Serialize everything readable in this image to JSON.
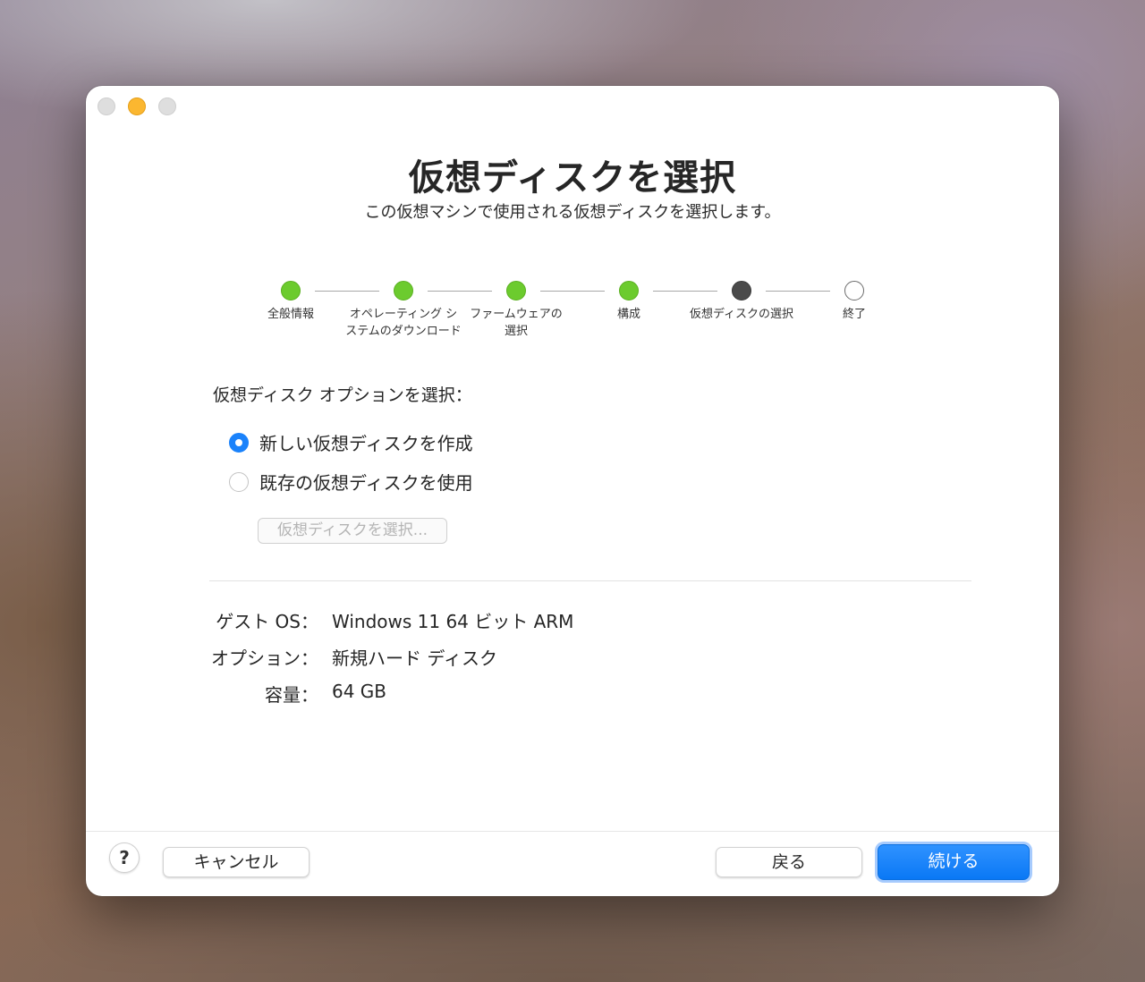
{
  "window": {
    "title": "仮想ディスクを選択",
    "subtitle": "この仮想マシンで使用される仮想ディスクを選択します。"
  },
  "steps": [
    {
      "label": "全般情報",
      "state": "done"
    },
    {
      "label": "オペレーティング システムのダウンロード",
      "state": "done"
    },
    {
      "label": "ファームウェアの 選択",
      "state": "done"
    },
    {
      "label": "構成",
      "state": "done"
    },
    {
      "label": "仮想ディスクの選択",
      "state": "current"
    },
    {
      "label": "終了",
      "state": "pending"
    }
  ],
  "options": {
    "section_label": "仮想ディスク オプションを選択：",
    "create_new_label": "新しい仮想ディスクを作成",
    "use_existing_label": "既存の仮想ディスクを使用",
    "selected": "create_new",
    "choose_button_label": "仮想ディスクを選択..."
  },
  "summary": {
    "guest_os_label": "ゲスト OS：",
    "guest_os_value": "Windows 11 64 ビット ARM",
    "option_label": "オプション：",
    "option_value": "新規ハード ディスク",
    "capacity_label": "容量：",
    "capacity_value": "64 GB"
  },
  "footer": {
    "help_label": "?",
    "cancel_label": "キャンセル",
    "back_label": "戻る",
    "continue_label": "続ける"
  },
  "colors": {
    "accent": "#1a82fb",
    "step_done": "#6ccb2e",
    "step_current": "#4a4a4a"
  }
}
